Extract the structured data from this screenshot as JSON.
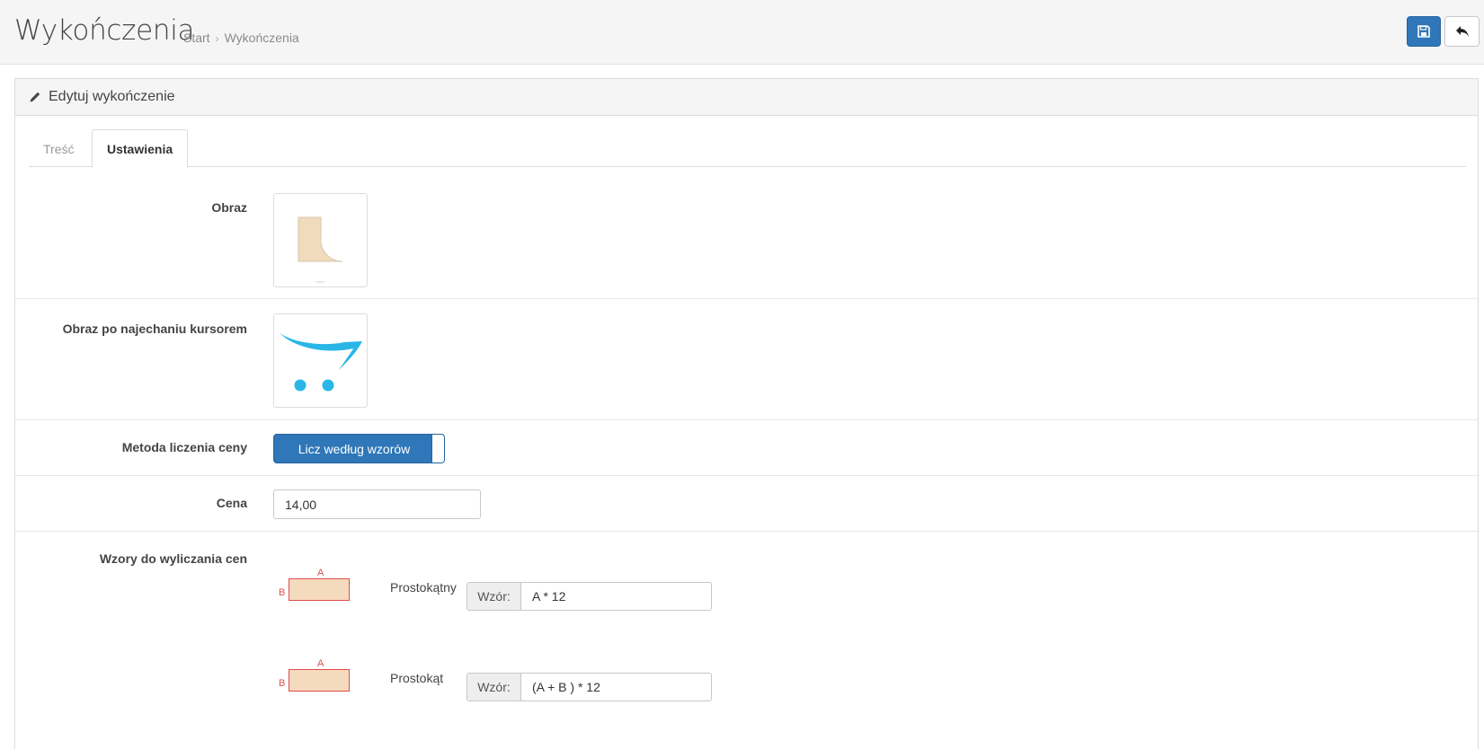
{
  "header": {
    "title": "Wykończenia",
    "breadcrumb": [
      "Start",
      "Wykończenia"
    ],
    "breadcrumb_sep": "›"
  },
  "panel": {
    "title": "Edytuj wykończenie"
  },
  "tabs": [
    {
      "label": "Treść",
      "active": false
    },
    {
      "label": "Ustawienia",
      "active": true
    }
  ],
  "form": {
    "image_label": "Obraz",
    "hover_image_label": "Obraz po najechaniu kursorem",
    "price_method_label": "Metoda liczenia ceny",
    "price_method_value": "Licz według wzorów",
    "price_label": "Cena",
    "price_value": "14,00",
    "formulas_label": "Wzory do wyliczania cen",
    "formulas": [
      {
        "name": "Prostokątny",
        "addon": "Wzór:",
        "value": "A * 12",
        "dim_a": "A",
        "dim_b": "B"
      },
      {
        "name": "Prostokąt",
        "addon": "Wzór:",
        "value": "(A + B ) * 12",
        "dim_a": "A",
        "dim_b": "B"
      }
    ]
  },
  "colors": {
    "primary": "#2f77b8",
    "shape_fill": "#f5dbbe",
    "shape_border": "#e04b4b",
    "cart_blue": "#29b6e6"
  },
  "icons": {
    "save": "floppy-disk-icon",
    "back": "reply-arrow-icon",
    "edit": "pencil-icon"
  }
}
